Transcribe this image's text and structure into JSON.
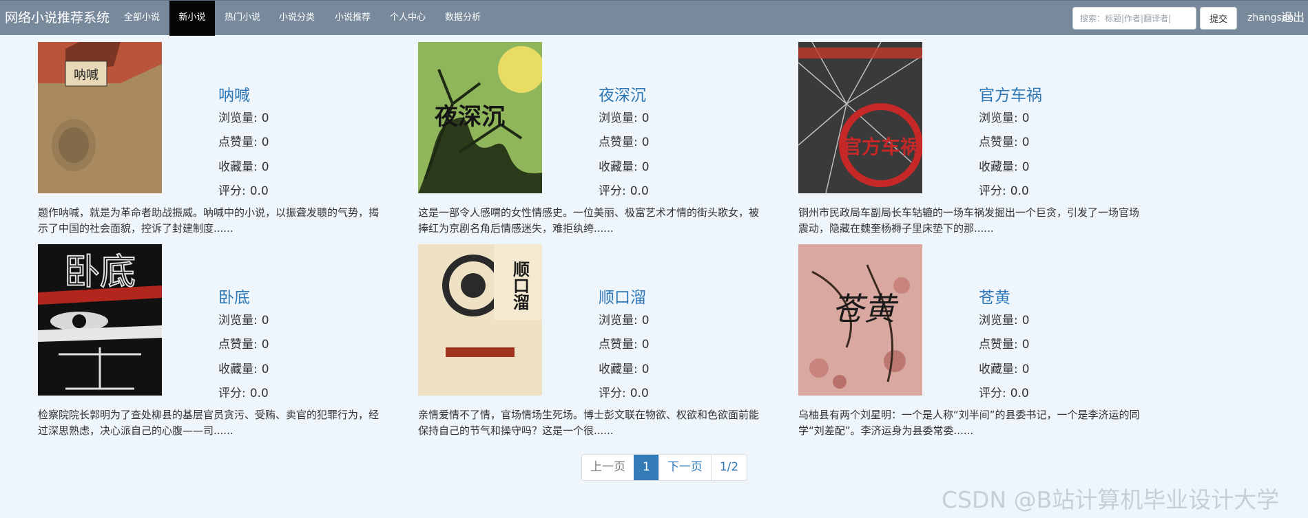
{
  "nav": {
    "brand": "网络小说推荐系统",
    "items": [
      "全部小说",
      "新小说",
      "热门小说",
      "小说分类",
      "小说推荐",
      "个人中心",
      "数据分析"
    ],
    "active_index": 1,
    "search_placeholder": "搜索：标题|作者|翻译者|",
    "submit_label": "提交",
    "username": "zhangsan",
    "logout_label": "退出"
  },
  "stat_labels": {
    "views": "浏览量:",
    "likes": "点赞量:",
    "favorites": "收藏量:",
    "rating": "评分:"
  },
  "books": [
    {
      "title": "呐喊",
      "views": "0",
      "likes": "0",
      "favorites": "0",
      "rating": "0.0",
      "description": "题作呐喊，就是为革命者助战振威。呐喊中的小说，以振聋发聩的气势，揭示了中国的社会面貌，控诉了封建制度......",
      "cover_text": "呐喊",
      "cover_color": "#a88a5e"
    },
    {
      "title": "夜深沉",
      "views": "0",
      "likes": "0",
      "favorites": "0",
      "rating": "0.0",
      "description": "这是一部令人感喟的女性情感史。一位美丽、极富艺术才情的街头歌女，被捧红为京剧名角后情感迷失，难拒纨绔......",
      "cover_text": "夜深沉",
      "cover_color": "#8fb65a"
    },
    {
      "title": "官方车祸",
      "views": "0",
      "likes": "0",
      "favorites": "0",
      "rating": "0.0",
      "description": "铜州市民政局车副局长车轱辘的一场车祸发掘出一个巨贪，引发了一场官场震动，隐藏在魏奎杨褥子里床垫下的那......",
      "cover_text": "官方车祸",
      "cover_color": "#3a3a3a"
    },
    {
      "title": "卧底",
      "views": "0",
      "likes": "0",
      "favorites": "0",
      "rating": "0.0",
      "description": "检察院院长郭明为了查处柳县的基层官员贪污、受贿、卖官的犯罪行为，经过深思熟虑，决心派自己的心腹——司......",
      "cover_text": "卧底",
      "cover_color": "#111111"
    },
    {
      "title": "顺口溜",
      "views": "0",
      "likes": "0",
      "favorites": "0",
      "rating": "0.0",
      "description": "亲情爱情不了情，官场情场生死场。博士彭文联在物欲、权欲和色欲面前能保持自己的节气和操守吗？这是一个很......",
      "cover_text": "顺口溜",
      "cover_color": "#efe2c4"
    },
    {
      "title": "苍黄",
      "views": "0",
      "likes": "0",
      "favorites": "0",
      "rating": "0.0",
      "description": "乌柚县有两个刘星明：一个是人称“刘半间”的县委书记，一个是李济运的同学“刘差配”。李济运身为县委常委......",
      "cover_text": "苍黄",
      "cover_color": "#d9a8a0"
    }
  ],
  "pagination": {
    "prev": "上一页",
    "current": "1",
    "next": "下一页",
    "total": "1/2"
  },
  "watermark": "CSDN @B站计算机毕业设计大学"
}
